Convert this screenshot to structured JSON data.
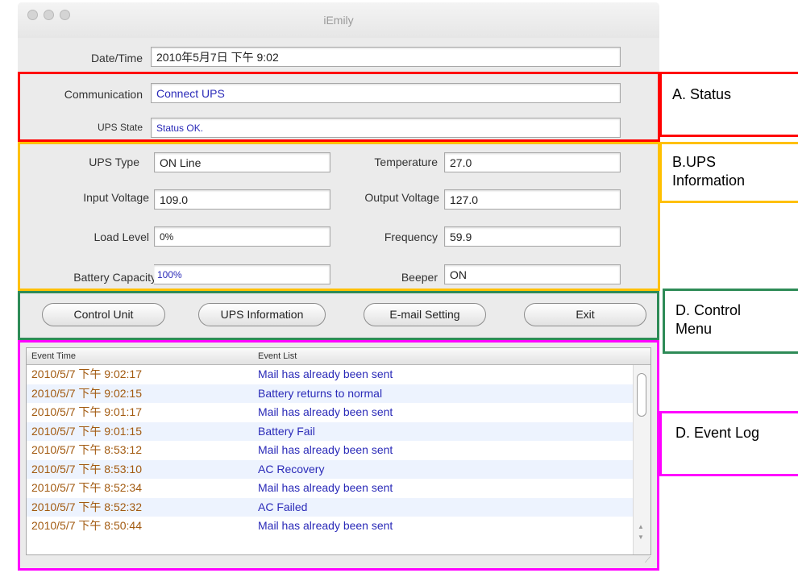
{
  "window": {
    "title": "iEmily"
  },
  "fields": {
    "datetime_label": "Date/Time",
    "datetime_value": "2010年5月7日 下午 9:02",
    "communication_label": "Communication",
    "communication_value": "Connect UPS",
    "ups_state_label": "UPS State",
    "ups_state_value": "Status OK.",
    "ups_type_label": "UPS Type",
    "ups_type_value": "ON Line",
    "temperature_label": "Temperature",
    "temperature_value": "27.0",
    "input_voltage_label": "Input Voltage",
    "input_voltage_value": "109.0",
    "output_voltage_label": "Output Voltage",
    "output_voltage_value": "127.0",
    "load_level_label": "Load Level",
    "load_level_value": "0%",
    "frequency_label": "Frequency",
    "frequency_value": "59.9",
    "battery_capacity_label": "Battery Capacity",
    "battery_capacity_value": "100%",
    "beeper_label": "Beeper",
    "beeper_value": "ON"
  },
  "buttons": {
    "control_unit": "Control Unit",
    "ups_information": "UPS Information",
    "email_setting": "E-mail Setting",
    "exit": "Exit"
  },
  "event_log": {
    "col_time": "Event Time",
    "col_event": "Event List",
    "rows": [
      {
        "time": "2010/5/7 下午 9:02:17",
        "event": "Mail has already been sent"
      },
      {
        "time": "2010/5/7 下午 9:02:15",
        "event": "Battery returns to normal"
      },
      {
        "time": "2010/5/7 下午 9:01:17",
        "event": "Mail has already been sent"
      },
      {
        "time": "2010/5/7 下午 9:01:15",
        "event": "Battery Fail"
      },
      {
        "time": "2010/5/7 下午 8:53:12",
        "event": "Mail has already been sent"
      },
      {
        "time": "2010/5/7 下午 8:53:10",
        "event": "AC Recovery"
      },
      {
        "time": "2010/5/7 下午 8:52:34",
        "event": "Mail has already been sent"
      },
      {
        "time": "2010/5/7 下午 8:52:32",
        "event": "AC Failed"
      },
      {
        "time": "2010/5/7 下午 8:50:44",
        "event": "Mail has already been sent"
      }
    ]
  },
  "annotations": {
    "status": "A. Status",
    "ups_info": "B.UPS Information",
    "control_menu": "D. Control Menu",
    "event_log": "D. Event Log"
  },
  "colors": {
    "status_box": "#ff0000",
    "ups_info_box": "#ffc000",
    "control_menu_box": "#2e8b57",
    "event_log_box": "#ff00ff"
  }
}
